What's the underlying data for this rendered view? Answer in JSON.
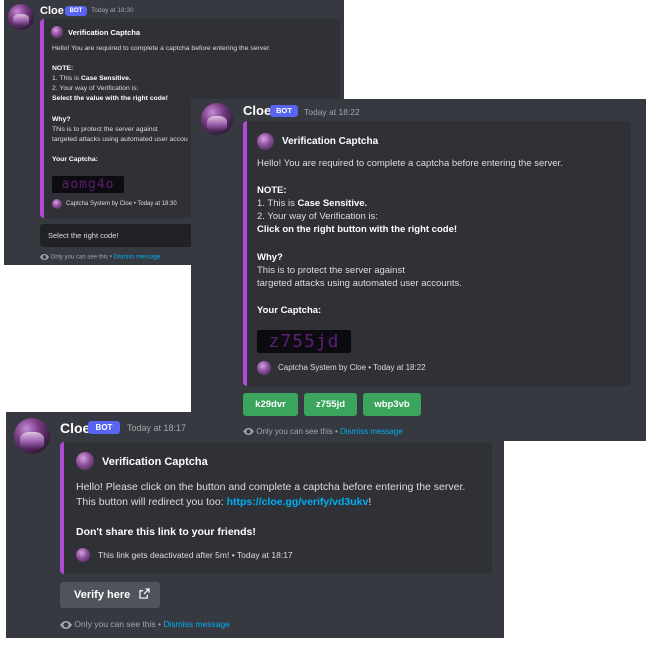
{
  "panel1": {
    "username": "Cloe",
    "bot_tag": "BOT",
    "timestamp": "Today at 18:30",
    "embed_title": "Verification Captcha",
    "intro": "Hello! You are required to complete a captcha before entering the server.",
    "note_label": "NOTE:",
    "note1_prefix": "1. This is ",
    "note1_bold": "Case Sensitive.",
    "note2": "2. Your way of Verification is:",
    "note3": "Select the value with the right code!",
    "why_label": "Why?",
    "why1": "This is to protect the server against",
    "why2": "targeted attacks using automated user accou",
    "captcha_label": "Your Captcha:",
    "captcha_value": "aomg4o",
    "footer": "Captcha System by Cloe • Today at 18:30",
    "select_placeholder": "Select the right code!",
    "ephemeral_prefix": "Only you can see this • ",
    "dismiss": "Dismiss message"
  },
  "panel2": {
    "username": "Cloe",
    "bot_tag": "BOT",
    "timestamp": "Today at 18:22",
    "embed_title": "Verification Captcha",
    "intro": "Hello! You are required to complete a captcha before entering the server.",
    "note_label": "NOTE:",
    "note1_prefix": "1. This is ",
    "note1_bold": "Case Sensitive.",
    "note2": "2. Your way of Verification is:",
    "note3": "Click on the right button with the right code!",
    "why_label": "Why?",
    "why1": "This is to protect the server against",
    "why2": "targeted attacks using automated user accounts.",
    "captcha_label": "Your Captcha:",
    "captcha_value": "z755jd",
    "footer": "Captcha System by Cloe • Today at 18:22",
    "buttons": [
      "k29dvr",
      "z755jd",
      "wbp3vb"
    ],
    "ephemeral_prefix": "Only you can see this • ",
    "dismiss": "Dismiss message"
  },
  "panel3": {
    "username": "Cloe",
    "bot_tag": "BOT",
    "timestamp": "Today at 18:17",
    "embed_title": "Verification Captcha",
    "line1": "Hello! Please click on the button and complete a captcha before entering the server.",
    "line2_prefix": "This button will redirect you too: ",
    "link": "https://cloe.gg/verify/vd3ukv",
    "line2_suffix": "!",
    "warning": "Don't share this link to your friends!",
    "footer": "This link gets deactivated after 5m! • Today at 18:17",
    "verify_button": "Verify here",
    "ephemeral_prefix": "Only you can see this • ",
    "dismiss": "Dismiss message"
  },
  "colors": {
    "background": "#36393f",
    "embed": "#2f3136",
    "embed_border": "#b04bd6",
    "bot_badge": "#5865f2",
    "green_button": "#3ba55d",
    "grey_button": "#4f545c",
    "link": "#00aff4"
  }
}
